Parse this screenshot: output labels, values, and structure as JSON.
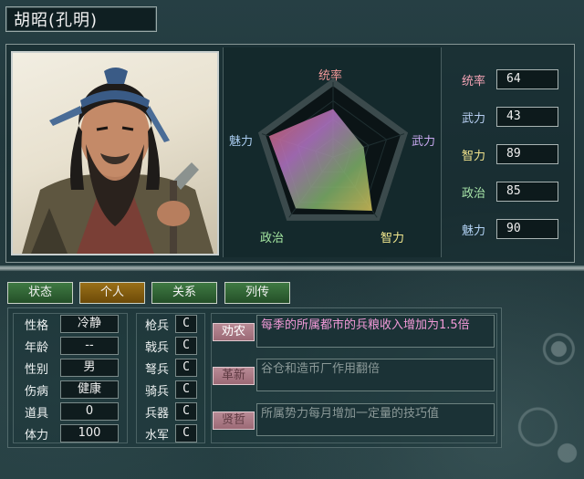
{
  "name": "胡昭(孔明)",
  "radar": {
    "labels": {
      "top": "统率",
      "right": "武力",
      "bottom_right": "智力",
      "bottom_left": "政治",
      "left": "魅力"
    },
    "values": {
      "统率": 64,
      "武力": 43,
      "智力": 89,
      "政治": 85,
      "魅力": 90
    },
    "max": 100,
    "label_colors": {
      "统率": "#f39a9a",
      "武力": "#c8a8f0",
      "智力": "#f3e98e",
      "政治": "#a4e6a0",
      "魅力": "#a9ccf0"
    }
  },
  "stats": [
    {
      "label": "统率",
      "value": "64",
      "color": "#f3a3b5"
    },
    {
      "label": "武力",
      "value": "43",
      "color": "#b8cff2"
    },
    {
      "label": "智力",
      "value": "89",
      "color": "#f0e28c"
    },
    {
      "label": "政治",
      "value": "85",
      "color": "#a7e4a8"
    },
    {
      "label": "魅力",
      "value": "90",
      "color": "#b2d2f4"
    }
  ],
  "tabs": [
    "状态",
    "个人",
    "关系",
    "列传"
  ],
  "active_tab": "个人",
  "personal": [
    {
      "label": "性格",
      "value": "冷静"
    },
    {
      "label": "年龄",
      "value": "--"
    },
    {
      "label": "性别",
      "value": "男"
    },
    {
      "label": "伤病",
      "value": "健康"
    },
    {
      "label": "道具",
      "value": "0"
    },
    {
      "label": "体力",
      "value": "100"
    }
  ],
  "aptitudes": [
    {
      "label": "枪兵",
      "value": "C"
    },
    {
      "label": "戟兵",
      "value": "C"
    },
    {
      "label": "弩兵",
      "value": "C"
    },
    {
      "label": "骑兵",
      "value": "C"
    },
    {
      "label": "兵器",
      "value": "C"
    },
    {
      "label": "水军",
      "value": "C"
    }
  ],
  "skills": [
    {
      "tag": "劝农",
      "desc": "每季的所属都市的兵粮收入增加为1.5倍",
      "active": true
    },
    {
      "tag": "革新",
      "desc": "谷仓和造币厂作用翻倍",
      "active": false
    },
    {
      "tag": "贤哲",
      "desc": "所属势力每月增加一定量的技巧值",
      "active": false
    }
  ]
}
